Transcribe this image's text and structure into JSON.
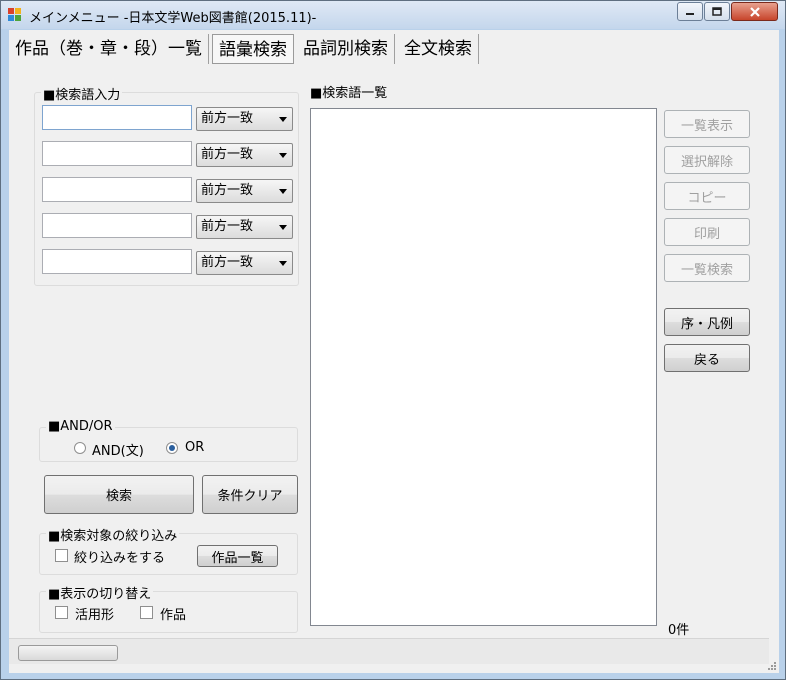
{
  "window": {
    "title": "メインメニュー -日本文学Web図書館(2015.11)-"
  },
  "menu": {
    "items": [
      {
        "label": "作品（巻・章・段）一覧"
      },
      {
        "label": "語彙検索"
      },
      {
        "label": "品詞別検索"
      },
      {
        "label": "全文検索"
      }
    ]
  },
  "search_input": {
    "group_title": "■検索語入力",
    "rows": [
      {
        "value": "",
        "match": "前方一致"
      },
      {
        "value": "",
        "match": "前方一致"
      },
      {
        "value": "",
        "match": "前方一致"
      },
      {
        "value": "",
        "match": "前方一致"
      },
      {
        "value": "",
        "match": "前方一致"
      }
    ]
  },
  "andor": {
    "group_title": "■AND/OR",
    "options": [
      {
        "label": "AND(文)",
        "checked": false
      },
      {
        "label": "OR",
        "checked": true
      }
    ]
  },
  "actions": {
    "search_label": "検索",
    "clear_label": "条件クリア"
  },
  "filter": {
    "group_title": "■検索対象の絞り込み",
    "checkbox_label": "絞り込みをする",
    "checked": false,
    "works_button_label": "作品一覧"
  },
  "display": {
    "group_title": "■表示の切り替え",
    "options": [
      {
        "label": "活用形",
        "checked": false
      },
      {
        "label": "作品",
        "checked": false
      }
    ]
  },
  "results": {
    "title": "■検索語一覧",
    "count": "0件"
  },
  "side_buttons": {
    "list_view": "一覧表示",
    "deselect": "選択解除",
    "copy": "コピー",
    "print": "印刷",
    "list_search": "一覧検索",
    "preface": "序・凡例",
    "back": "戻る"
  }
}
